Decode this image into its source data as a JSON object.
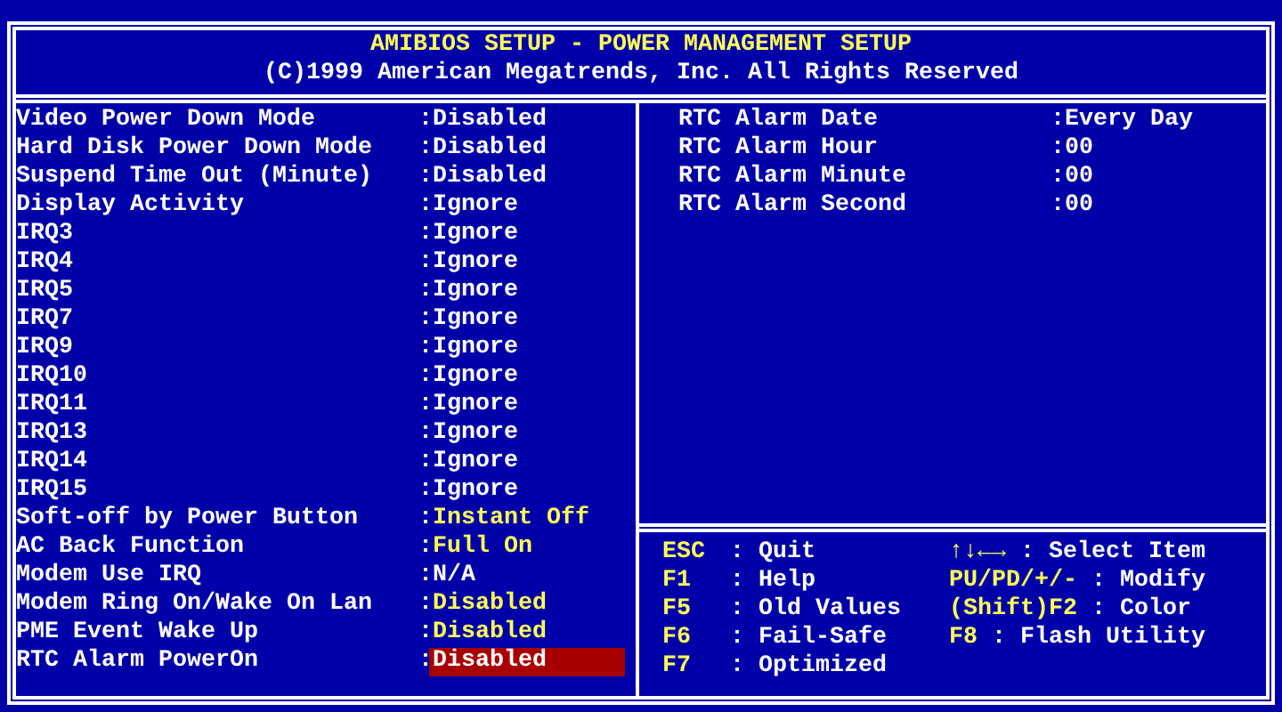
{
  "header": {
    "title": "AMIBIOS SETUP - POWER MANAGEMENT SETUP",
    "copyright": "(C)1999 American Megatrends, Inc. All Rights Reserved"
  },
  "settings": [
    {
      "label": "Video Power Down Mode",
      "sep": ":",
      "value": "Disabled",
      "kind": "default",
      "selected": false
    },
    {
      "label": "Hard Disk Power Down Mode",
      "sep": ":",
      "value": "Disabled",
      "kind": "default",
      "selected": false
    },
    {
      "label": "Suspend Time Out (Minute)",
      "sep": ":",
      "value": "Disabled",
      "kind": "default",
      "selected": false
    },
    {
      "label": "Display Activity",
      "sep": ":",
      "value": "Ignore",
      "kind": "default",
      "selected": false
    },
    {
      "label": "IRQ3",
      "sep": ":",
      "value": "Ignore",
      "kind": "default",
      "selected": false
    },
    {
      "label": "IRQ4",
      "sep": ":",
      "value": "Ignore",
      "kind": "default",
      "selected": false
    },
    {
      "label": "IRQ5",
      "sep": ":",
      "value": "Ignore",
      "kind": "default",
      "selected": false
    },
    {
      "label": "IRQ7",
      "sep": ":",
      "value": "Ignore",
      "kind": "default",
      "selected": false
    },
    {
      "label": "IRQ9",
      "sep": ":",
      "value": "Ignore",
      "kind": "default",
      "selected": false
    },
    {
      "label": "IRQ10",
      "sep": ":",
      "value": "Ignore",
      "kind": "default",
      "selected": false
    },
    {
      "label": "IRQ11",
      "sep": ":",
      "value": "Ignore",
      "kind": "default",
      "selected": false
    },
    {
      "label": "IRQ13",
      "sep": ":",
      "value": "Ignore",
      "kind": "default",
      "selected": false
    },
    {
      "label": "IRQ14",
      "sep": ":",
      "value": "Ignore",
      "kind": "default",
      "selected": false
    },
    {
      "label": "IRQ15",
      "sep": ":",
      "value": "Ignore",
      "kind": "default",
      "selected": false
    },
    {
      "label": "Soft-off by Power Button",
      "sep": ":",
      "value": "Instant Off",
      "kind": "changed",
      "selected": false
    },
    {
      "label": "AC Back Function",
      "sep": ":",
      "value": "Full On",
      "kind": "changed",
      "selected": false
    },
    {
      "label": "Modem Use IRQ",
      "sep": ":",
      "value": "N/A",
      "kind": "default",
      "selected": false
    },
    {
      "label": "Modem Ring On/Wake On Lan",
      "sep": ":",
      "value": "Disabled",
      "kind": "changed",
      "selected": false
    },
    {
      "label": "PME Event Wake Up",
      "sep": ":",
      "value": "Disabled",
      "kind": "changed",
      "selected": false
    },
    {
      "label": "RTC Alarm PowerOn",
      "sep": ":",
      "value": "Disabled",
      "kind": "default",
      "selected": true
    }
  ],
  "alarm_settings": [
    {
      "label": "RTC Alarm Date",
      "sep": ":",
      "value": "Every Day"
    },
    {
      "label": "RTC Alarm Hour",
      "sep": ":",
      "value": "00"
    },
    {
      "label": "RTC Alarm Minute",
      "sep": ":",
      "value": "00"
    },
    {
      "label": "RTC Alarm Second",
      "sep": ":",
      "value": "00"
    }
  ],
  "help_left": [
    {
      "key": "ESC",
      "action": ": Quit"
    },
    {
      "key": "F1",
      "action": ": Help"
    },
    {
      "key": "F5",
      "action": ": Old Values"
    },
    {
      "key": "F6",
      "action": ": Fail-Safe"
    },
    {
      "key": "F7",
      "action": ": Optimized"
    }
  ],
  "help_right": [
    {
      "key": "↑↓←→",
      "action": ": Select Item"
    },
    {
      "key": "PU/PD/+/-",
      "action": ": Modify"
    },
    {
      "key": "(Shift)F2",
      "action": ": Color"
    },
    {
      "key": "F8",
      "action": ": Flash Utility"
    }
  ]
}
